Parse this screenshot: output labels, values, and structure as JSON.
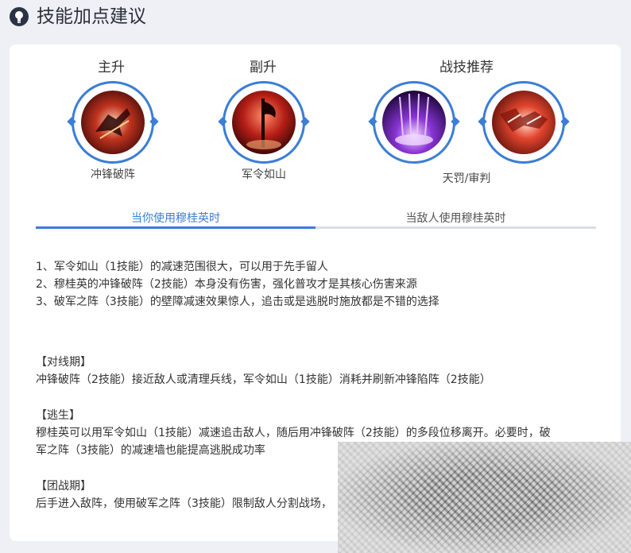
{
  "header": {
    "title": "技能加点建议",
    "icon": "lightbulb-icon"
  },
  "groups": {
    "main_label": "主升",
    "secondary_label": "副升",
    "summoner_label": "战技推荐"
  },
  "skills": {
    "main": {
      "name": "冲锋破阵",
      "icon": "charge-skill-icon"
    },
    "secondary": {
      "name": "军令如山",
      "icon": "command-skill-icon"
    },
    "summoner": {
      "name": "天罚/审判",
      "icons": [
        "punish-spell-icon",
        "judgement-spell-icon"
      ]
    }
  },
  "tabs": [
    {
      "label": "当你使用穆桂英时",
      "active": true
    },
    {
      "label": "当敌人使用穆桂英时",
      "active": false
    }
  ],
  "tips": [
    "1、军令如山（1技能）的减速范围很大，可以用于先手留人",
    "2、穆桂英的冲锋破阵（2技能）本身没有伤害，强化普攻才是其核心伤害来源",
    "3、破军之阵（3技能）的壁障减速效果惊人，追击或是逃脱时施放都是不错的选择"
  ],
  "phases": {
    "laning": {
      "heading": "【对线期】",
      "text": "冲锋破阵（2技能）接近敌人或清理兵线，军令如山（1技能）消耗并刷新冲锋陷阵（2技能）"
    },
    "escape": {
      "heading": "【逃生】",
      "text_line1": "穆桂英可以用军令如山（1技能）减速追击敌人，随后用冲锋破阵（2技能）的多段位移离开。必要时，破",
      "text_line2": "军之阵（3技能）的减速墙也能提高逃脱成功率"
    },
    "teamfight": {
      "heading": "【团战期】",
      "text": "后手进入敌阵，使用破军之阵（3技能）限制敌人分割战场，"
    }
  },
  "colors": {
    "accent": "#3a7ed6",
    "background": "#eef0f5"
  }
}
